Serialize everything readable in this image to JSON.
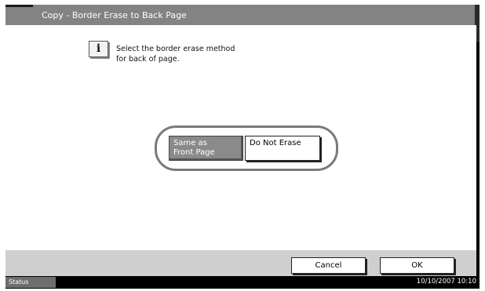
{
  "header": {
    "title": "Copy - Border Erase to Back Page"
  },
  "message": {
    "icon": "info-icon",
    "icon_glyph": "i",
    "line1": "Select the border erase method",
    "line2": "for back of page."
  },
  "options": {
    "same_as_front": {
      "line1": "Same as",
      "line2": "Front Page"
    },
    "do_not_erase": "Do Not Erase"
  },
  "footer": {
    "cancel": "Cancel",
    "ok": "OK"
  },
  "status_bar": {
    "status": "Status",
    "datetime": "10/10/2007  10:10"
  }
}
